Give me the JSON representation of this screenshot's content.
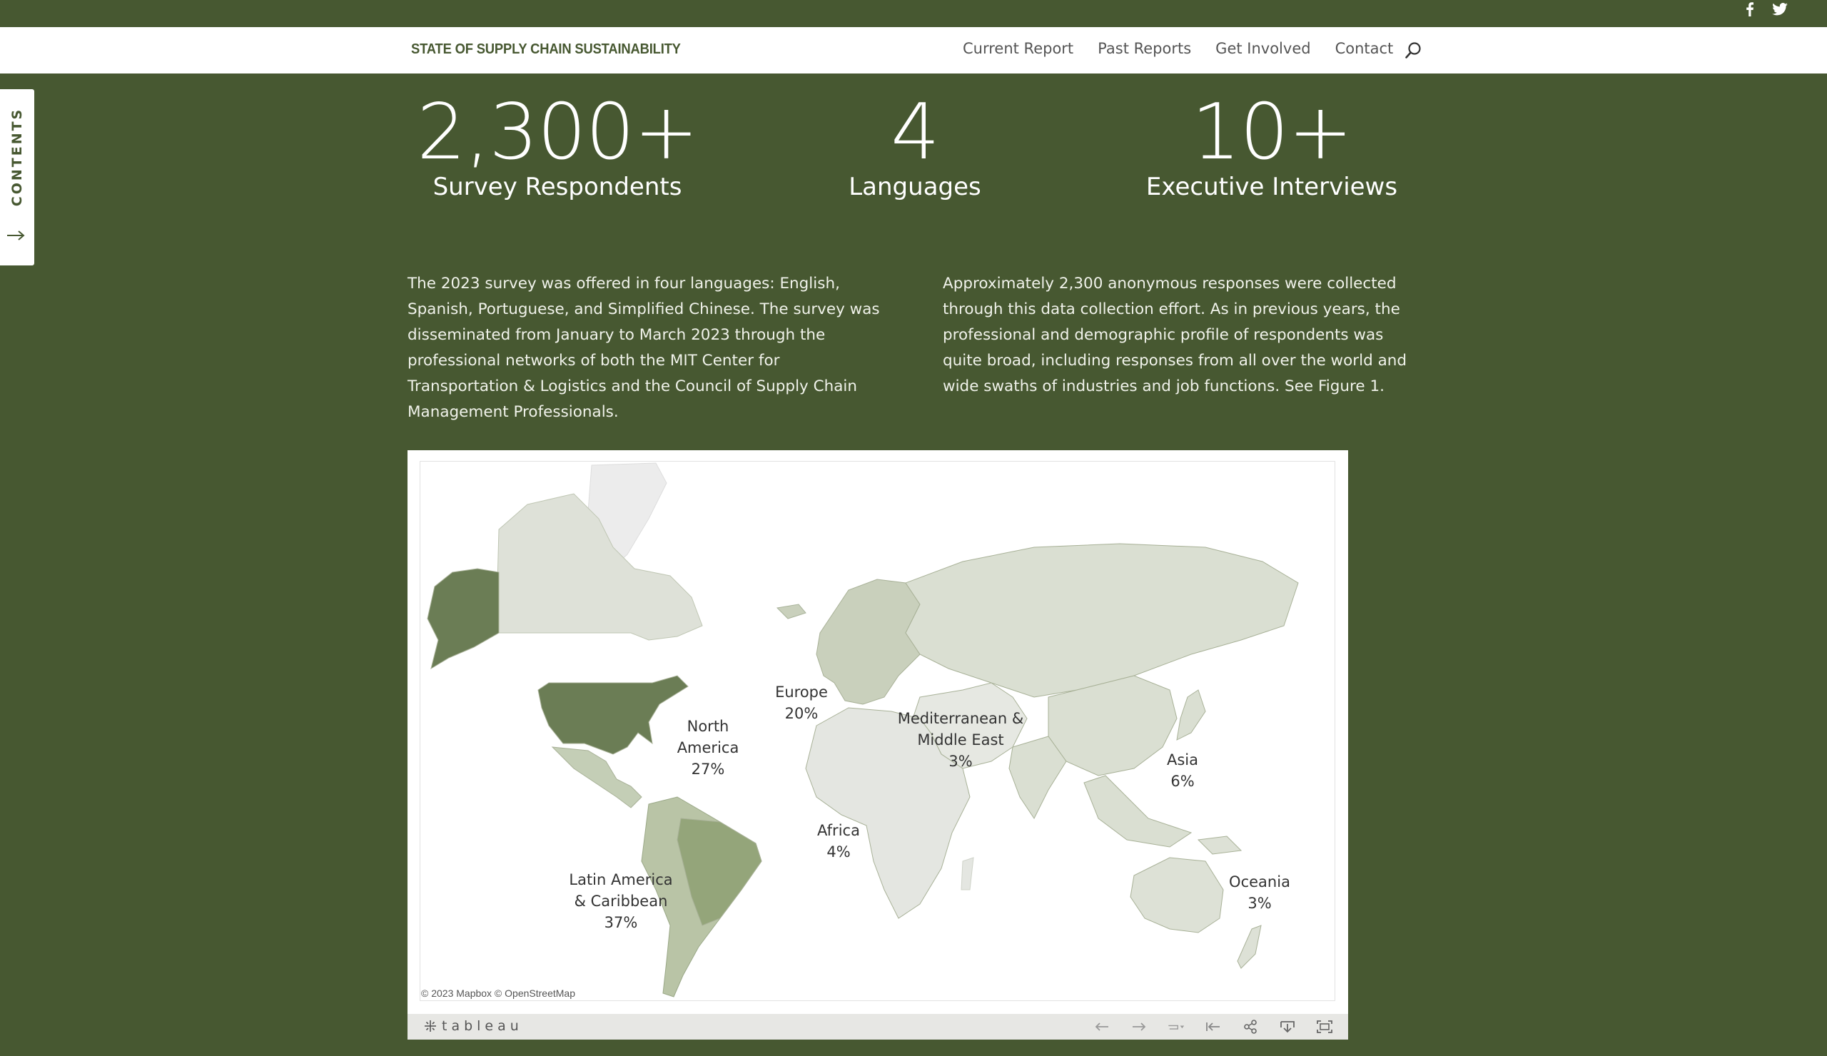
{
  "social": {
    "facebook_icon": "facebook-icon",
    "twitter_icon": "twitter-icon"
  },
  "header": {
    "logo": "STATE OF SUPPLY CHAIN SUSTAINABILITY",
    "menu": [
      "Current Report",
      "Past Reports",
      "Get Involved",
      "Contact"
    ],
    "search_icon": "search-icon"
  },
  "sidebar": {
    "label": "CONTENTS",
    "arrow_icon": "arrow-right-icon"
  },
  "stats": [
    {
      "value": "2,300+",
      "label": "Survey Respondents"
    },
    {
      "value": "4",
      "label": "Languages"
    },
    {
      "value": "10+",
      "label": "Executive Interviews"
    }
  ],
  "paragraphs": [
    "The 2023 survey was offered in four languages: English, Spanish, Portuguese, and Simplified Chinese. The survey was disseminated from January to March 2023 through the professional networks of both the MIT Center for Transportation & Logistics and the Council of Supply Chain Management Professionals.",
    "Approximately 2,300 anonymous responses were collected through this data collection effort. As in previous years, the professional and demographic profile of respondents was quite broad, including responses from all over the world and wide swaths of industries and job functions. See Figure 1."
  ],
  "map": {
    "regions": [
      {
        "name": "North America",
        "lines": [
          "North",
          "America",
          "27%"
        ],
        "percent": 27,
        "color": "#6b7d55"
      },
      {
        "name": "Europe",
        "lines": [
          "Europe",
          "20%"
        ],
        "percent": 20,
        "color": "#c9d0bc"
      },
      {
        "name": "Mediterranean & Middle East",
        "lines": [
          "Mediterranean &",
          "Middle East",
          "3%"
        ],
        "percent": 3,
        "color": "#e6e8e2"
      },
      {
        "name": "Asia",
        "lines": [
          "Asia",
          "6%"
        ],
        "percent": 6,
        "color": "#dadfd2"
      },
      {
        "name": "Africa",
        "lines": [
          "Africa",
          "4%"
        ],
        "percent": 4,
        "color": "#e4e6e1"
      },
      {
        "name": "Latin America & Caribbean",
        "lines": [
          "Latin America",
          "& Caribbean",
          "37%"
        ],
        "percent": 37,
        "color": "#94a57a"
      },
      {
        "name": "Oceania",
        "lines": [
          "Oceania",
          "3%"
        ],
        "percent": 3,
        "color": "#dde1d6"
      }
    ],
    "copyright": "© 2023 Mapbox © OpenStreetMap"
  },
  "toolbar": {
    "brand": "tableau",
    "tools": [
      "undo-icon",
      "redo-icon",
      "revert-icon",
      "reset-icon",
      "share-icon",
      "download-icon",
      "fullscreen-icon"
    ]
  }
}
